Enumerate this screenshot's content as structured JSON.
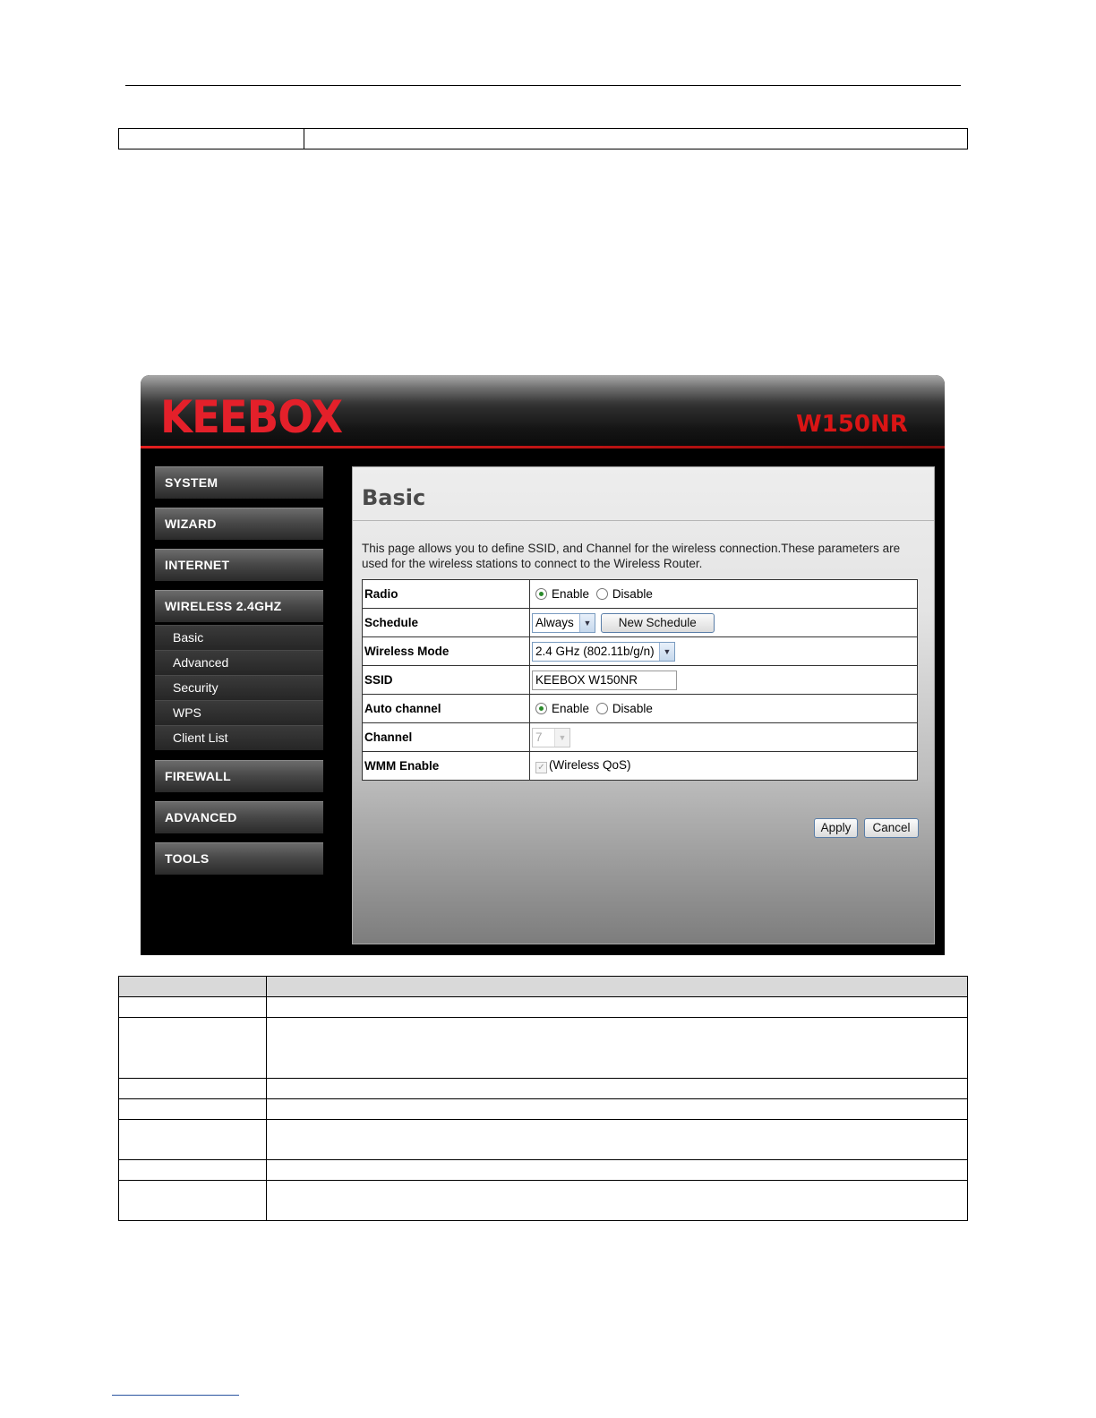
{
  "router": {
    "brand": "KEEBOX",
    "model": "W150NR",
    "nav": {
      "main_top": [
        "SYSTEM",
        "WIZARD",
        "INTERNET",
        "WIRELESS 2.4GHZ"
      ],
      "sub": [
        "Basic",
        "Advanced",
        "Security",
        "WPS",
        "Client List"
      ],
      "main_bottom": [
        "FIREWALL",
        "ADVANCED",
        "TOOLS"
      ]
    },
    "page": {
      "title": "Basic",
      "description": "This page allows you to define SSID, and Channel for the wireless connection.These parameters are used for the wireless stations to connect to the Wireless Router.",
      "fields": {
        "radio_label": "Radio",
        "schedule_label": "Schedule",
        "wireless_mode_label": "Wireless Mode",
        "ssid_label": "SSID",
        "auto_channel_label": "Auto channel",
        "channel_label": "Channel",
        "wmm_label": "WMM Enable"
      },
      "options": {
        "enable": "Enable",
        "disable": "Disable"
      },
      "radio_value": "Enable",
      "auto_channel_value": "Enable",
      "schedule_value": "Always",
      "new_schedule_button": "New Schedule",
      "wireless_mode_value": "2.4 GHz (802.11b/g/n)",
      "ssid_value": "KEEBOX W150NR",
      "channel_value": "7",
      "wmm_checked": true,
      "wmm_text": "(Wireless QoS)",
      "apply_button": "Apply",
      "cancel_button": "Cancel"
    }
  }
}
